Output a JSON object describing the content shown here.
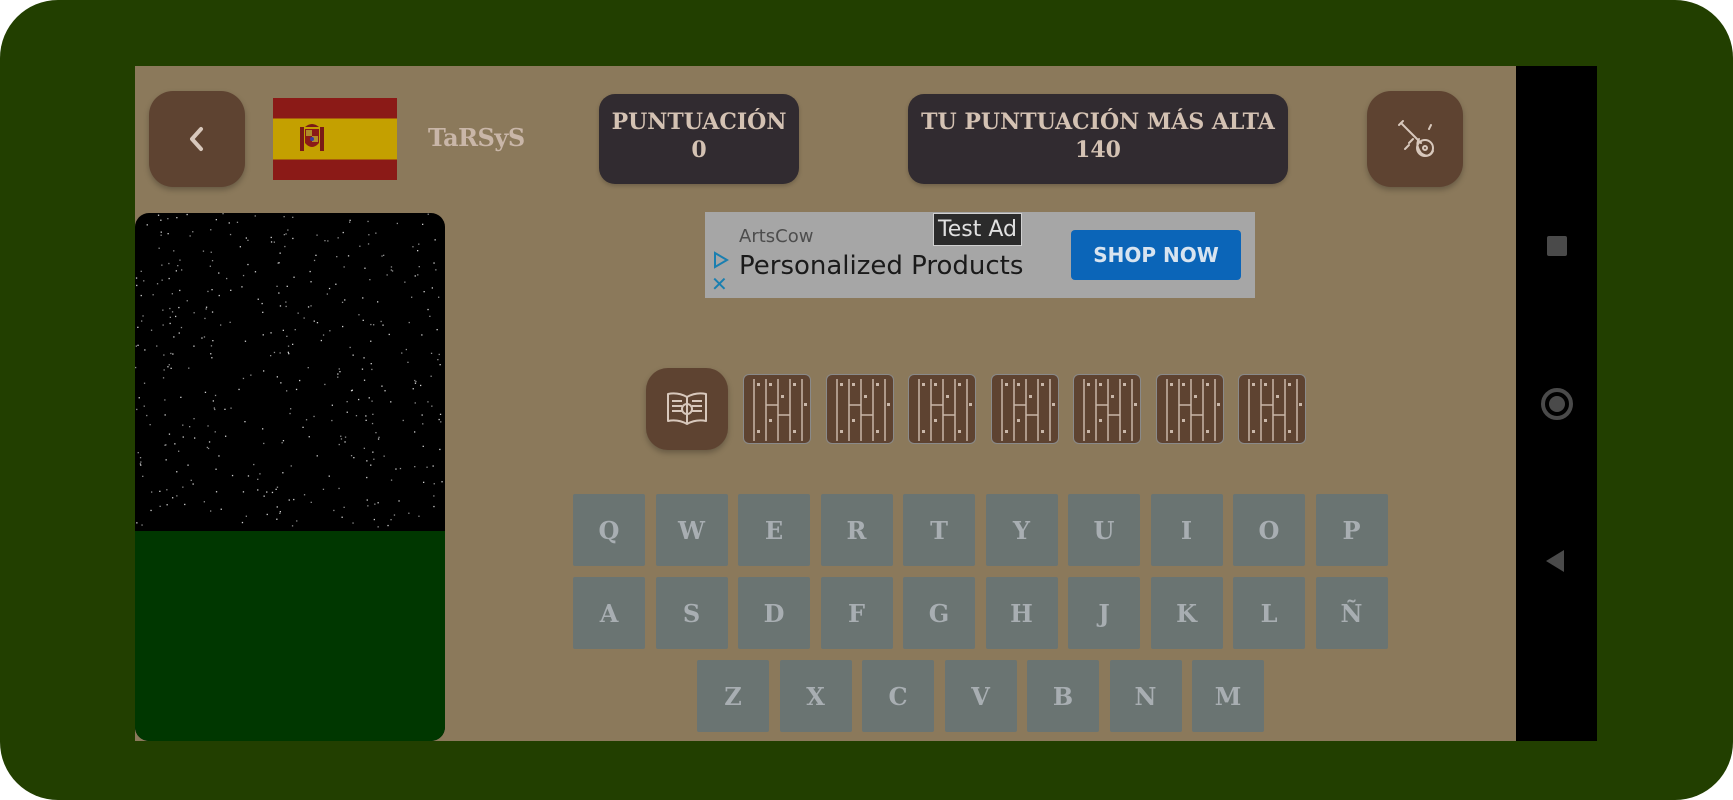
{
  "brand": "TaRSyS",
  "score": {
    "label": "PUNTUACIÓN",
    "value": "0"
  },
  "high_score": {
    "label": "TU PUNTUACIÓN MÁS ALTA",
    "value": "140"
  },
  "ad": {
    "tag": "Test Ad",
    "advertiser": "ArtsCow",
    "headline": "Personalized Products",
    "cta": "SHOP NOW"
  },
  "word_slots": 7,
  "keyboard": {
    "row1": [
      "Q",
      "W",
      "E",
      "R",
      "T",
      "Y",
      "U",
      "I",
      "O",
      "P"
    ],
    "row2": [
      "A",
      "S",
      "D",
      "F",
      "G",
      "H",
      "J",
      "K",
      "L",
      "Ñ"
    ],
    "row3": [
      "Z",
      "X",
      "C",
      "V",
      "B",
      "N",
      "M"
    ]
  },
  "colors": {
    "background": "#8b795b",
    "button": "#5e4331",
    "score_panel": "#312b30",
    "key": "#6a7472",
    "ground": "#003700",
    "ad_cta": "#0b65b8"
  },
  "icons": {
    "back": "chevron-left-icon",
    "guitar": "guitar-icon",
    "book": "open-book-icon",
    "flag": "spain-flag-icon"
  }
}
